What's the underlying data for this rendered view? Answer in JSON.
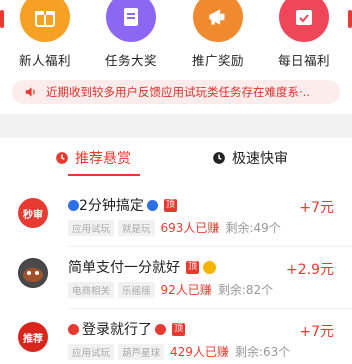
{
  "quick_entries": [
    {
      "label": "新人福利",
      "icon": "gift-icon",
      "color": "#f6a123"
    },
    {
      "label": "任务大奖",
      "icon": "task-doc-icon",
      "color": "#8b67f4"
    },
    {
      "label": "推广奖励",
      "icon": "megaphone-icon",
      "color": "#f08a2e"
    },
    {
      "label": "每日福利",
      "icon": "calendar-check-icon",
      "color": "#f0465a"
    }
  ],
  "notice": {
    "icon": "speaker-icon",
    "text": "近期收到较多用户反馈应用试玩类任务存在难度系·.."
  },
  "tabs": [
    {
      "label": "推荐悬赏",
      "icon": "clock-icon",
      "active": true
    },
    {
      "label": "极速快审",
      "icon": "clock-icon",
      "active": false
    }
  ],
  "tasks": [
    {
      "title": "2分钟搞定",
      "badge": "顶",
      "tags": [
        "应用试玩",
        "就是玩"
      ],
      "taken": "693人已赚",
      "remaining": "剩余:49个",
      "reward": "+7元",
      "avatar_text": "秒审"
    },
    {
      "title": "简单支付一分就好",
      "badge": "顶",
      "tags": [
        "电商相关",
        "乐摇摇"
      ],
      "taken": "92人已赚",
      "remaining": "剩余:82个",
      "reward": "+2.9元",
      "avatar_text": ""
    },
    {
      "title": "登录就行了",
      "badge": "顶",
      "tags": [
        "应用试玩",
        "葫芦星球"
      ],
      "taken": "429人已赚",
      "remaining": "剩余:63个",
      "reward": "+7元",
      "avatar_text": "推荐"
    }
  ],
  "colors": {
    "accent": "#e8392f"
  }
}
